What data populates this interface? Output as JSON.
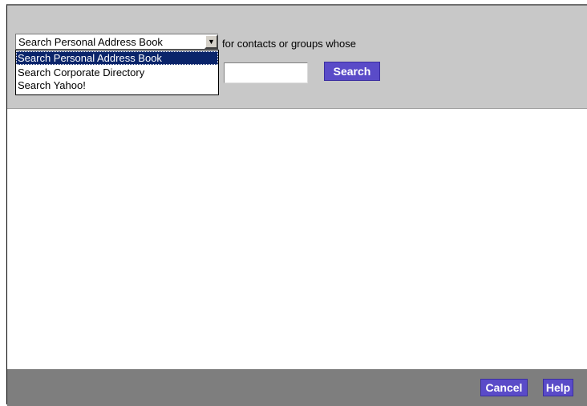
{
  "search_scope": {
    "selected_label": "Search Personal Address Book",
    "options": [
      {
        "label": "Search Personal Address Book",
        "selected": true
      },
      {
        "label": "Search Corporate Directory",
        "selected": false
      },
      {
        "label": "Search  Yahoo!",
        "selected": false
      }
    ],
    "arrow_icon": "chevron-down-icon"
  },
  "criteria_text": "for contacts or groups whose",
  "query": {
    "value": ""
  },
  "buttons": {
    "search": "Search",
    "cancel": "Cancel",
    "help": "Help"
  },
  "colors": {
    "button_bg": "#5a4bc8",
    "panel_bg": "#c8c8c8",
    "footer_bg": "#7e7e7e",
    "selection_bg": "#0a246a"
  }
}
